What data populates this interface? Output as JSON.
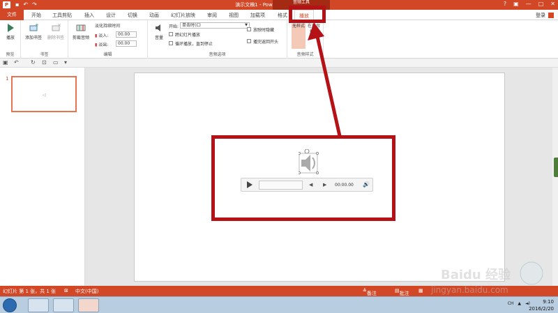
{
  "title_bar": {
    "app_icon": "P",
    "document_title": "演示文稿1 - PowerPoint(产品激活失败)",
    "context_tab_group": "音频工具",
    "help": "?",
    "minimize": "—",
    "restore": "□",
    "close": "✕"
  },
  "tabs": {
    "file": "文件",
    "items": [
      "开始",
      "工具剪贴",
      "插入",
      "设计",
      "切换",
      "动画",
      "幻灯片放映",
      "审阅",
      "视图",
      "加载项",
      "格式"
    ],
    "active": "播放",
    "login": "登录"
  },
  "ribbon": {
    "preview": {
      "play_label": "播放",
      "group_label": "预览"
    },
    "bookmarks": {
      "add_label": "添加书签",
      "remove_label": "删除书签",
      "group_label": "书签"
    },
    "editing": {
      "trim_label": "剪裁音频",
      "fade_title": "淡化持续时间",
      "fade_in_label": "淡入:",
      "fade_in_value": "00.00",
      "fade_out_label": "淡出:",
      "fade_out_value": "00.00",
      "group_label": "编辑"
    },
    "audio_options": {
      "volume_label": "音量",
      "start_label": "开始:",
      "start_value": "单击时(C)",
      "across_slides": "跨幻灯片播放",
      "loop": "循环播放，直到停止",
      "hide_during_show": "放映时隐藏",
      "rewind": "播完返回开头",
      "group_label": "音频选项"
    },
    "audio_styles": {
      "no_style": "无样式",
      "bg_play": "在后台播放",
      "group_label": "音频样式"
    }
  },
  "slides": {
    "number": "1",
    "thumb_glyph": "◁"
  },
  "player": {
    "time": "00:00.00"
  },
  "status": {
    "slide_info": "幻灯片 第 1 张，共 1 张",
    "language": "中文(中国)",
    "notes": "备注",
    "comments": "批注"
  },
  "taskbar": {
    "tray_lang": "CH",
    "time": "9:10",
    "date": "2016/2/20"
  },
  "watermark": {
    "text": "jingyan.baidu.com",
    "brand": "Baidu 经验"
  },
  "colors": {
    "accent": "#d24726",
    "annotation": "#b51218"
  }
}
